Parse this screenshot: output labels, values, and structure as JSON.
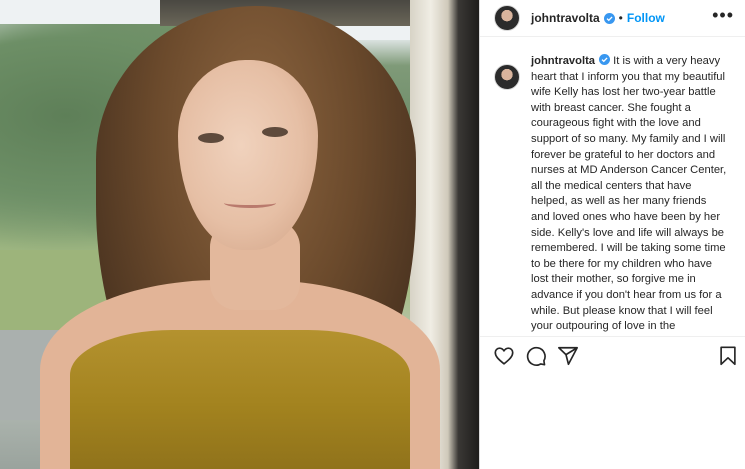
{
  "post": {
    "author": "johntravolta",
    "follow_label": "Follow",
    "separator": "•",
    "more_label": "•••",
    "caption": "It is with a very heavy heart that I inform you that my beautiful wife Kelly has lost her two-year battle with breast cancer. She fought a courageous fight with the love and support of so many.  My family and I will forever be grateful to her doctors and nurses at MD Anderson Cancer Center, all the medical centers that have helped, as well as her many friends and loved ones who have been by her side. Kelly's love and life will always be remembered. I will be taking some time to be there for my children who have lost their mother, so forgive me in advance if you don't hear from us for a while.  But please know that I will feel your outpouring of love in the"
  },
  "icons": {
    "verified": "verified-badge-icon",
    "like": "heart-icon",
    "comment": "comment-icon",
    "share": "paper-plane-icon",
    "save": "bookmark-icon"
  },
  "colors": {
    "accent": "#0095f6",
    "text": "#262626",
    "border": "#dbdbdb"
  }
}
